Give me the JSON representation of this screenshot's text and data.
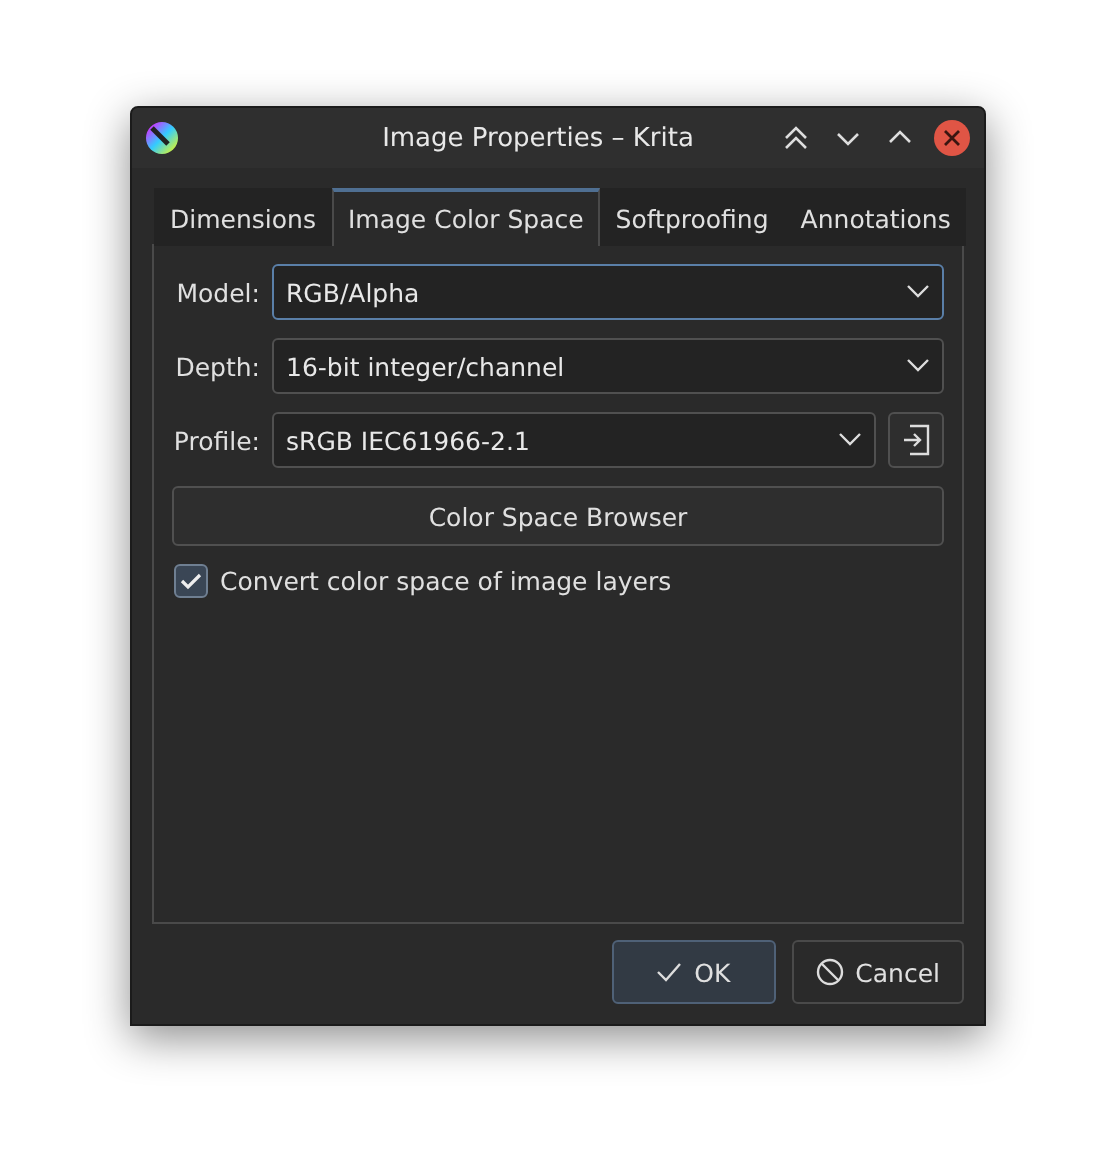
{
  "window": {
    "title": "Image Properties – Krita"
  },
  "tabs": [
    {
      "label": "Dimensions",
      "selected": false
    },
    {
      "label": "Image Color Space",
      "selected": true
    },
    {
      "label": "Softproofing",
      "selected": false
    },
    {
      "label": "Annotations",
      "selected": false
    }
  ],
  "fields": [
    {
      "label": "Model:",
      "value": "RGB/Alpha",
      "focused": true,
      "import_button": false
    },
    {
      "label": "Depth:",
      "value": "16-bit integer/channel",
      "focused": false,
      "import_button": false
    },
    {
      "label": "Profile:",
      "value": "sRGB IEC61966-2.1",
      "focused": false,
      "import_button": true
    }
  ],
  "browser_button": "Color Space Browser",
  "convert_checkbox": {
    "label": "Convert color space of image layers",
    "checked": true
  },
  "buttons": [
    {
      "label": "OK",
      "kind": "ok"
    },
    {
      "label": "Cancel",
      "kind": "cancel"
    }
  ]
}
